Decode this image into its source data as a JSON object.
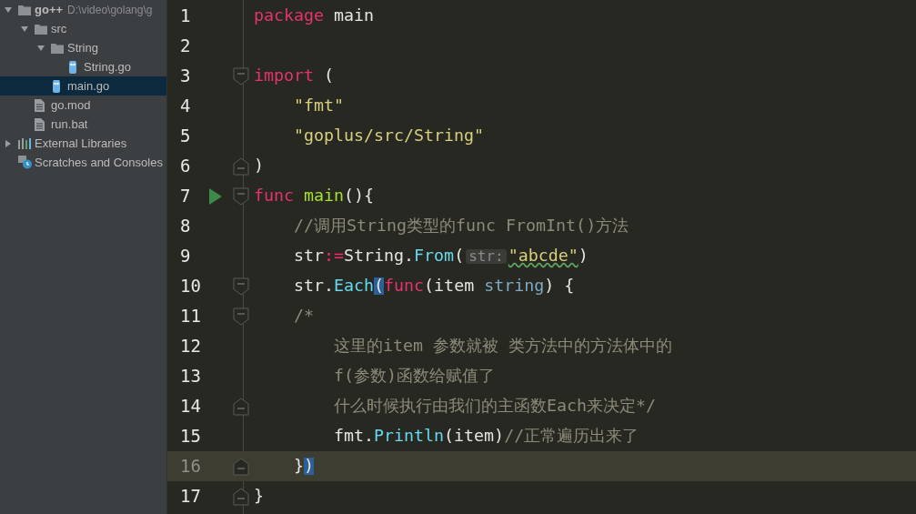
{
  "project_tree": [
    {
      "name": "go++",
      "path": "D:\\video\\golang\\g",
      "kind": "module",
      "expanded": true,
      "selected": false,
      "children": [
        {
          "name": "src",
          "kind": "folder",
          "expanded": true,
          "selected": false,
          "children": [
            {
              "name": "String",
              "kind": "folder",
              "expanded": true,
              "selected": false,
              "children": [
                {
                  "name": "String.go",
                  "kind": "gofile",
                  "selected": false
                }
              ]
            },
            {
              "name": "main.go",
              "kind": "gofile",
              "selected": true
            }
          ]
        },
        {
          "name": "go.mod",
          "kind": "file",
          "selected": false
        },
        {
          "name": "run.bat",
          "kind": "file",
          "selected": false
        }
      ]
    },
    {
      "name": "External Libraries",
      "kind": "libraries",
      "expanded": false,
      "selected": false
    },
    {
      "name": "Scratches and Consoles",
      "kind": "scratches",
      "selected": false
    }
  ],
  "editor": {
    "lines": [
      {
        "number": "1",
        "current": false,
        "runnable": false,
        "fold_start": false,
        "fold_end": false,
        "tokens": [
          {
            "kind": "keyword",
            "text": "package"
          },
          {
            "kind": "plain",
            "text": " main"
          }
        ]
      },
      {
        "number": "2",
        "current": false,
        "runnable": false,
        "fold_start": false,
        "fold_end": false
      },
      {
        "number": "3",
        "current": false,
        "runnable": false,
        "fold_start": true,
        "fold_end": false,
        "tokens": [
          {
            "kind": "keyword",
            "text": "import"
          },
          {
            "kind": "plain",
            "text": " ("
          }
        ],
        "children": [
          {
            "number": "4",
            "current": false,
            "runnable": false,
            "fold_start": false,
            "fold_end": false,
            "tokens": [
              {
                "kind": "string",
                "text": "\"fmt\""
              }
            ]
          },
          {
            "number": "5",
            "current": false,
            "runnable": false,
            "fold_start": false,
            "fold_end": false,
            "tokens": [
              {
                "kind": "string",
                "text": "\"goplus/src/String\""
              }
            ]
          }
        ]
      },
      {
        "number": "6",
        "current": false,
        "runnable": false,
        "fold_start": false,
        "fold_end": true,
        "tokens": [
          {
            "kind": "plain",
            "text": ")"
          }
        ]
      },
      {
        "number": "7",
        "current": false,
        "runnable": true,
        "fold_start": true,
        "fold_end": false,
        "tokens": [
          {
            "kind": "keyword",
            "text": "func"
          },
          {
            "kind": "function",
            "text": " main"
          },
          {
            "kind": "plain",
            "text": "(){"
          }
        ],
        "children": [
          {
            "number": "8",
            "current": false,
            "runnable": false,
            "fold_start": false,
            "fold_end": false,
            "tokens": [
              {
                "kind": "comment",
                "text": "//调用String类型的func FromInt()方法"
              }
            ]
          },
          {
            "number": "9",
            "current": false,
            "runnable": false,
            "fold_start": false,
            "fold_end": false,
            "tokens": [
              {
                "kind": "plain",
                "text": "str"
              },
              {
                "kind": "operator",
                "text": ":="
              },
              {
                "kind": "plain",
                "text": "String."
              },
              {
                "kind": "method",
                "text": "From"
              },
              {
                "kind": "plain",
                "text": "("
              },
              {
                "kind": "hint",
                "text": "str:"
              },
              {
                "kind": "typo",
                "text": "\"abcde\""
              },
              {
                "kind": "plain",
                "text": ")"
              }
            ]
          },
          {
            "number": "10",
            "current": false,
            "runnable": false,
            "fold_start": true,
            "fold_end": false,
            "tokens": [
              {
                "kind": "plain",
                "text": "str."
              },
              {
                "kind": "method",
                "text": "Each"
              },
              {
                "kind": "match",
                "text": "("
              },
              {
                "kind": "keyword",
                "text": "func"
              },
              {
                "kind": "plain",
                "text": "(item "
              },
              {
                "kind": "type",
                "text": "string"
              },
              {
                "kind": "plain",
                "text": ") {"
              }
            ]
          },
          {
            "number": "11",
            "current": false,
            "runnable": false,
            "fold_start": true,
            "fold_end": false,
            "tokens": [
              {
                "kind": "comment",
                "text": "/*"
              }
            ],
            "children": [
              {
                "number": "12",
                "current": false,
                "runnable": false,
                "fold_start": false,
                "fold_end": false,
                "tokens": [
                  {
                    "kind": "comment",
                    "text": "这里的item 参数就被 类方法中的方法体中的"
                  }
                ]
              },
              {
                "number": "13",
                "current": false,
                "runnable": false,
                "fold_start": false,
                "fold_end": false,
                "tokens": [
                  {
                    "kind": "comment",
                    "text": "f(参数)函数给赋值了"
                  }
                ]
              },
              {
                "number": "14",
                "current": false,
                "runnable": false,
                "fold_start": false,
                "fold_end": true,
                "tokens": [
                  {
                    "kind": "comment",
                    "text": "什么时候执行由我们的主函数Each来决定*/"
                  }
                ]
              },
              {
                "number": "15",
                "current": false,
                "runnable": false,
                "fold_start": false,
                "fold_end": false,
                "tokens": [
                  {
                    "kind": "plain",
                    "text": "fmt."
                  },
                  {
                    "kind": "method",
                    "text": "Println"
                  },
                  {
                    "kind": "plain",
                    "text": "(item)"
                  },
                  {
                    "kind": "comment",
                    "text": "//正常遍历出来了"
                  }
                ]
              }
            ]
          },
          {
            "number": "16",
            "current": true,
            "runnable": false,
            "fold_start": false,
            "fold_end": true,
            "tokens": [
              {
                "kind": "plain",
                "text": "}"
              },
              {
                "kind": "match",
                "text": ")"
              }
            ]
          }
        ]
      },
      {
        "number": "17",
        "current": false,
        "runnable": false,
        "fold_start": false,
        "fold_end": true,
        "tokens": [
          {
            "kind": "plain",
            "text": "}"
          }
        ]
      }
    ]
  }
}
